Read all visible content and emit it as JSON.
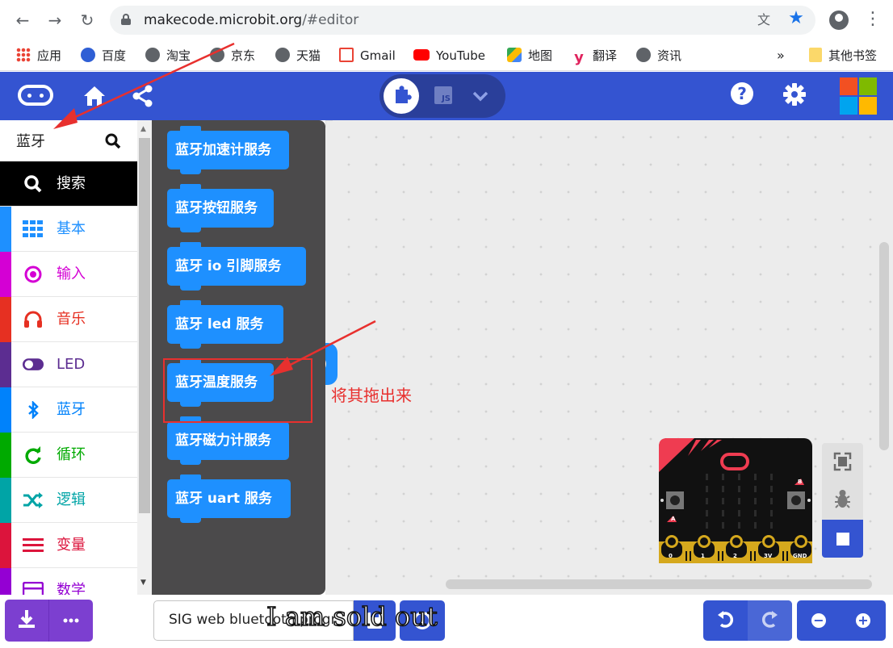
{
  "browser": {
    "url_host": "makecode.microbit.org",
    "url_path": "/#editor",
    "bookmarks": [
      "应用",
      "百度",
      "淘宝",
      "京东",
      "天猫",
      "Gmail",
      "YouTube",
      "地图",
      "翻译",
      "资讯"
    ],
    "bookmarks_overflow": "»",
    "other_bookmarks": "其他书签"
  },
  "header": {
    "js_label": "JS",
    "help_label": "?"
  },
  "toolbox": {
    "search_value": "蓝牙",
    "categories": [
      {
        "label": "搜索",
        "color": "#000000",
        "icon": "search-icon"
      },
      {
        "label": "基本",
        "color": "#1e90ff",
        "icon": "grid-icon"
      },
      {
        "label": "输入",
        "color": "#d400d4",
        "icon": "target-icon"
      },
      {
        "label": "音乐",
        "color": "#e63022",
        "icon": "headphones-icon"
      },
      {
        "label": "LED",
        "color": "#5c2d91",
        "icon": "toggle-icon"
      },
      {
        "label": "蓝牙",
        "color": "#0082fb",
        "icon": "bluetooth-icon"
      },
      {
        "label": "循环",
        "color": "#00aa00",
        "icon": "loop-icon"
      },
      {
        "label": "逻辑",
        "color": "#00a4a6",
        "icon": "shuffle-icon"
      },
      {
        "label": "变量",
        "color": "#dc143c",
        "icon": "lines-icon"
      },
      {
        "label": "数学",
        "color": "#9400d3",
        "icon": "calculator-icon"
      }
    ]
  },
  "flyout": {
    "blocks": [
      "蓝牙加速计服务",
      "蓝牙按钮服务",
      "蓝牙 io 引脚服务",
      "蓝牙 led 服务",
      "蓝牙温度服务",
      "蓝牙磁力计服务",
      "蓝牙 uart 服务"
    ]
  },
  "simulator": {
    "pins": [
      "0",
      "1",
      "2",
      "3V",
      "GND"
    ],
    "button_a": "A",
    "button_b": "B"
  },
  "bottom": {
    "project_name": "SIG web bluetooth progr"
  },
  "annotation": {
    "text": "将其拖出来",
    "color": "#e8302e"
  },
  "watermark": "I am sold out"
}
